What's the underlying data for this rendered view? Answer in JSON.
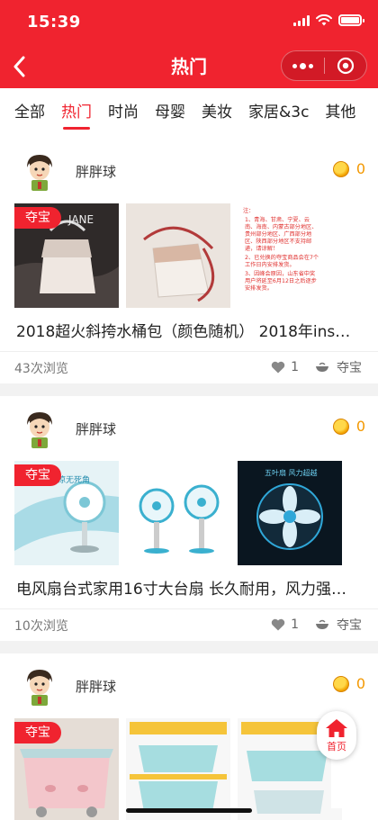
{
  "status": {
    "time": "15:39"
  },
  "header": {
    "title": "热门"
  },
  "tabs": [
    {
      "label": "全部",
      "active": false
    },
    {
      "label": "热门",
      "active": true
    },
    {
      "label": "时尚",
      "active": false
    },
    {
      "label": "母婴",
      "active": false
    },
    {
      "label": "美妆",
      "active": false
    },
    {
      "label": "家居&3c",
      "active": false
    },
    {
      "label": "其他",
      "active": false
    }
  ],
  "posts": [
    {
      "user": "胖胖球",
      "coins": "0",
      "tag": "夺宝",
      "title": "2018超火斜挎水桶包（颜色随机） 2018年ins…",
      "views": "43次浏览",
      "likes": "1",
      "action": "夺宝",
      "notice": "注：\n1、青海、甘肃、宁夏、云南、海南、内蒙古部分地区、贵州部分地区、广西部分地区、陕西部分地区不支持邮递，请谅解！\n2、已兑换的夺宝商品会在7个工作日内安排发货。\n3、因峰会原因，山东省中奖用户将延至6月12日之后逐步安排发货。"
    },
    {
      "user": "胖胖球",
      "coins": "0",
      "tag": "夺宝",
      "title": "电风扇台式家用16寸大台扇 长久耐用，风力强…",
      "views": "10次浏览",
      "likes": "1",
      "action": "夺宝"
    },
    {
      "user": "胖胖球",
      "coins": "0",
      "tag": "夺宝"
    }
  ],
  "home_button": {
    "label": "首页"
  },
  "colors": {
    "brand": "#f0232f",
    "coin": "#f39800"
  }
}
